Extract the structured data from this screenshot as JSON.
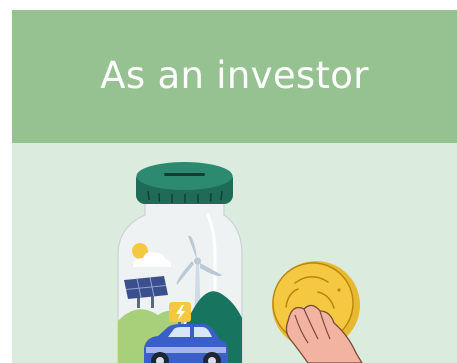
{
  "card": {
    "title": "As an investor"
  },
  "illustration": {
    "subject": "savings-jar-with-electric-car-and-coin",
    "icons": [
      "savings-jar-icon",
      "electric-car-icon",
      "solar-panel-icon",
      "wind-turbine-icon",
      "lightning-icon",
      "sun-icon",
      "cloud-icon",
      "gold-coin-icon",
      "hand-icon"
    ]
  },
  "colors": {
    "header": "#96c291",
    "body": "#dbebdd",
    "lid": "#1f6b58",
    "coin": "#f5c842",
    "car": "#3a5fc8",
    "hill": "#17755f"
  }
}
